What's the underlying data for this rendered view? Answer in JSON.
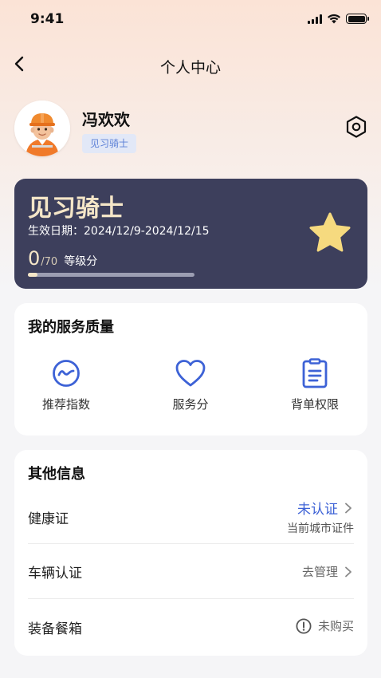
{
  "status_bar": {
    "time": "9:41"
  },
  "nav": {
    "title": "个人中心",
    "back_icon": "chevron-left-icon"
  },
  "profile": {
    "name": "冯欢欢",
    "level_tag": "见习骑士",
    "avatar_icon": "rider-avatar-icon",
    "settings_icon": "hexagon-settings-icon"
  },
  "rider_card": {
    "level": "见习骑士",
    "effective_date": "生效日期：2024/12/9-2024/12/15",
    "score": "0",
    "score_max": "/70",
    "score_label": "等级分",
    "progress_fraction": 0,
    "star_icon": "star-icon",
    "colors": {
      "background": "#3d3f5c",
      "accent": "#f5e6c8",
      "star": "#f6da7f"
    }
  },
  "service_quality": {
    "title": "我的服务质量",
    "items": [
      {
        "label": "推荐指数",
        "icon": "trend-circle-icon"
      },
      {
        "label": "服务分",
        "icon": "heart-icon"
      },
      {
        "label": "背单权限",
        "icon": "clipboard-list-icon"
      }
    ],
    "icon_color": "#3d62d6"
  },
  "other_info": {
    "title": "其他信息",
    "rows": [
      {
        "label": "健康证",
        "status": "未认证",
        "sub": "当前城市证件"
      },
      {
        "label": "车辆认证",
        "status": "去管理"
      },
      {
        "label": "装备餐箱",
        "status": "未购买",
        "icon": "alert-circle-icon"
      }
    ]
  }
}
